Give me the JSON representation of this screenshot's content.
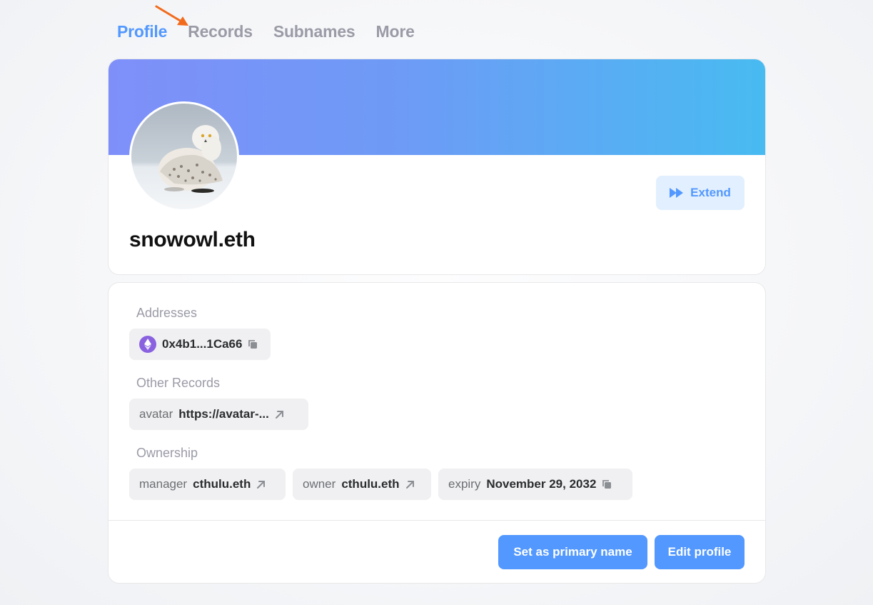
{
  "tabs": [
    {
      "label": "Profile",
      "active": true
    },
    {
      "label": "Records",
      "active": false
    },
    {
      "label": "Subnames",
      "active": false
    },
    {
      "label": "More",
      "active": false
    }
  ],
  "profile": {
    "name": "snowowl.eth",
    "extend_label": "Extend",
    "banner_colors": [
      "#7f8ff9",
      "#48bbf1"
    ]
  },
  "addresses": {
    "label": "Addresses",
    "eth_address": "0x4b1...1Ca66"
  },
  "other_records": {
    "label": "Other Records",
    "items": [
      {
        "key": "avatar",
        "value": "https://avatar-..."
      }
    ]
  },
  "ownership": {
    "label": "Ownership",
    "manager": {
      "key": "manager",
      "value": "cthulu.eth"
    },
    "owner": {
      "key": "owner",
      "value": "cthulu.eth"
    },
    "expiry": {
      "key": "expiry",
      "value": "November 29, 2032"
    }
  },
  "actions": {
    "primary_label": "Set as primary name",
    "edit_label": "Edit profile"
  },
  "colors": {
    "accent": "#5298ff",
    "annotation_arrow": "#f26b1d"
  }
}
